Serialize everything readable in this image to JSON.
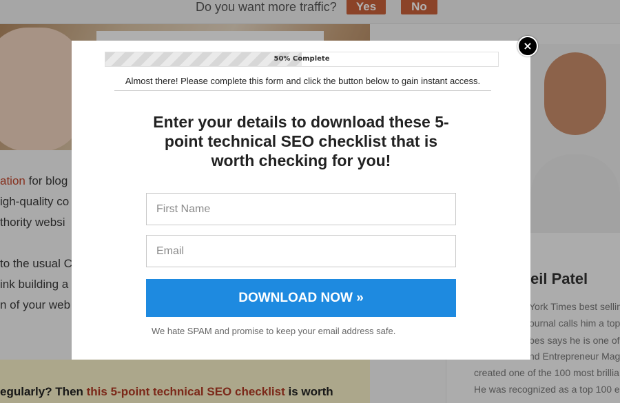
{
  "topbar": {
    "question": "Do you want more traffic?",
    "yes_label": "Yes",
    "no_label": "No"
  },
  "background": {
    "lines": [
      {
        "red": "ation",
        "text": " for blog"
      },
      {
        "red": "",
        "text": "igh-quality co"
      },
      {
        "red": "",
        "text": "thority websi"
      },
      {
        "red": "",
        "text": "to the usual C"
      },
      {
        "red": "",
        "text": "ink building a"
      },
      {
        "red": "",
        "text": "n of your web"
      }
    ],
    "highlight": {
      "prefix": "egularly? Then ",
      "link": "this 5-point technical SEO checklist",
      "suffix": " is worth"
    }
  },
  "sidebar": {
    "name": "eil Patel",
    "lines": [
      "York Times best sellin",
      "ournal calls him a top",
      "bes says he is one of",
      "nd Entrepreneur Maga",
      "created one of the 100 most brillia",
      "He was recognized as a top 100 e"
    ]
  },
  "modal": {
    "progress": {
      "label": "50% Complete",
      "percent": 50
    },
    "notice": "Almost there! Please complete this form and click the button below to gain instant access.",
    "headline": "Enter your details to download  these 5-point technical SEO checklist that is worth checking for you!",
    "first_name": {
      "value": "",
      "placeholder": "First Name"
    },
    "email": {
      "value": "",
      "placeholder": "Email"
    },
    "button_label": "DOWNLOAD NOW »",
    "spam_note": "We hate SPAM and promise to keep your email address safe.",
    "close_glyph": "×"
  },
  "colors": {
    "button_blue": "#1e8ae0",
    "topbar_button": "#c8613a",
    "link_red": "#c0452b"
  }
}
